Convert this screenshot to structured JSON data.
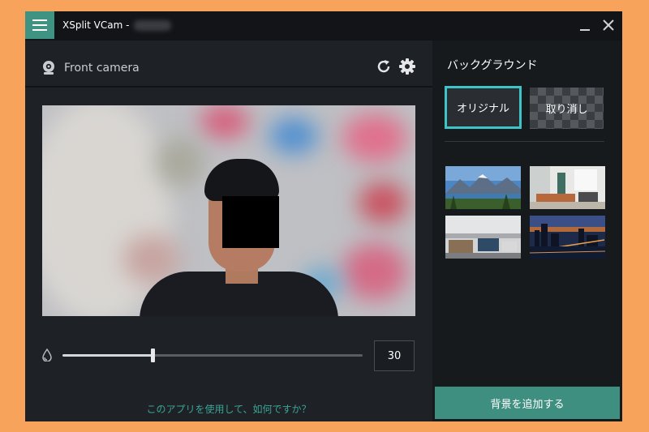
{
  "window": {
    "title": "XSplit VCam -"
  },
  "camera": {
    "name": "Front camera"
  },
  "blur_slider": {
    "value": "30",
    "level": 0.3
  },
  "footer": {
    "feedback_link": "このアプリを使用して、如何ですか？"
  },
  "background_panel": {
    "title": "バックグラウンド",
    "original_label": "オリジナル",
    "cancel_label": "取り消し",
    "add_button": "背景を追加する"
  },
  "colors": {
    "accent": "#3f9383",
    "selected_border": "#3cc4c8",
    "link": "#3aa596",
    "page_background": "#f7a35c"
  }
}
